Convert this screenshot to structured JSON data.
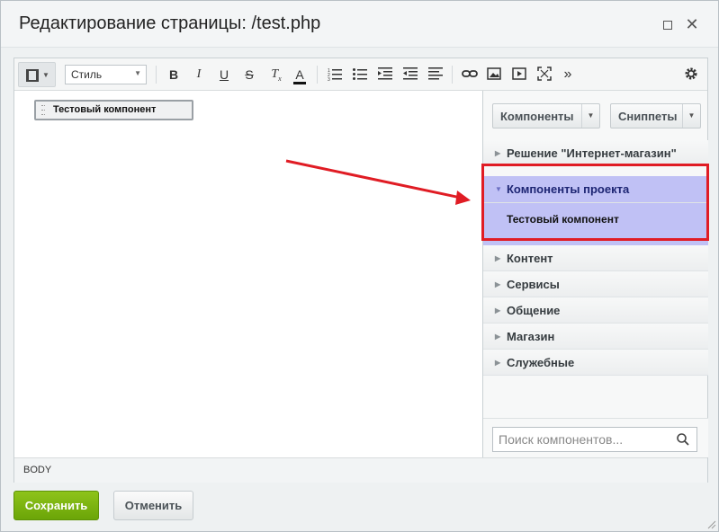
{
  "dialog": {
    "title": "Редактирование страницы: /test.php"
  },
  "toolbar": {
    "style_select": "Стиль",
    "icons": [
      "view-mode-icon",
      "bold-icon",
      "italic-icon",
      "underline-icon",
      "strikethrough-icon",
      "remove-format-icon",
      "font-color-icon",
      "ordered-list-icon",
      "unordered-list-icon",
      "indent-icon",
      "outdent-icon",
      "align-icon",
      "link-icon",
      "image-icon",
      "video-icon",
      "fullscreen-icon",
      "more-icon",
      "settings-icon"
    ]
  },
  "content": {
    "component_block": "Тестовый компонент"
  },
  "sidebar": {
    "components_btn": "Компоненты",
    "snippets_btn": "Сниппеты",
    "categories": [
      {
        "label": "Решение \"Интернет-магазин\""
      },
      {
        "label": "Компоненты проекта"
      },
      {
        "label": "Контент"
      },
      {
        "label": "Сервисы"
      },
      {
        "label": "Общение"
      },
      {
        "label": "Магазин"
      },
      {
        "label": "Служебные"
      }
    ],
    "expanded_item": "Тестовый компонент",
    "search_placeholder": "Поиск компонентов..."
  },
  "statusbar": {
    "path": "BODY"
  },
  "footer": {
    "save": "Сохранить",
    "cancel": "Отменить"
  },
  "colors": {
    "accent_green": "#7ab412",
    "selection": "#c0c1f5",
    "annotation_red": "#e01c24"
  }
}
